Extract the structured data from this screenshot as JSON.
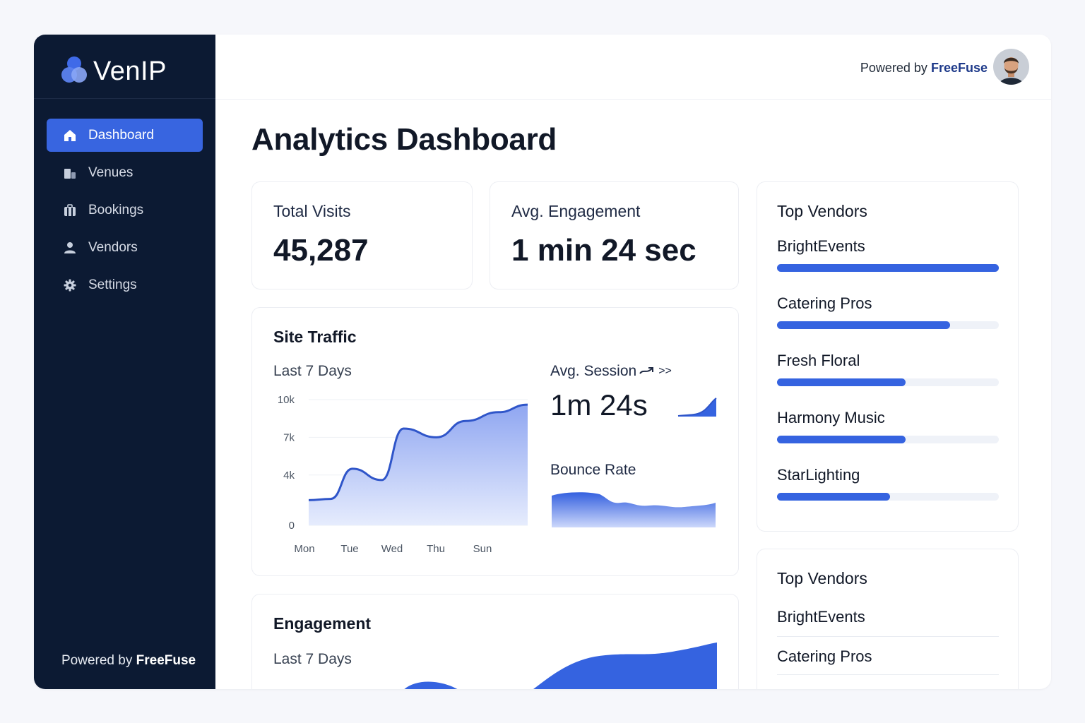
{
  "app": {
    "brand": "VenIP"
  },
  "sidebar": {
    "items": [
      {
        "label": "Dashboard",
        "icon": "home-icon",
        "active": true
      },
      {
        "label": "Venues",
        "icon": "building-icon"
      },
      {
        "label": "Bookings",
        "icon": "briefcase-icon"
      },
      {
        "label": "Vendors",
        "icon": "user-icon"
      },
      {
        "label": "Settings",
        "icon": "gear-icon"
      }
    ],
    "footer_prefix": "Powered by",
    "footer_brand": "FreeFuse"
  },
  "header": {
    "powered_prefix": "Powered by",
    "powered_brand": "FreeFuse"
  },
  "page": {
    "title": "Analytics Dashboard"
  },
  "stats": {
    "total_visits": {
      "label": "Total Visits",
      "value": "45,287"
    },
    "avg_engagement": {
      "label": "Avg. Engagement",
      "value": "1 min 24 sec"
    }
  },
  "traffic": {
    "title": "Site Traffic",
    "subtitle": "Last 7 Days",
    "avg_session_label": "Avg. Session",
    "avg_session_more": ">>",
    "avg_session_value": "1m 24s",
    "bounce_label": "Bounce Rate"
  },
  "engagement": {
    "title": "Engagement",
    "subtitle": "Last 7 Days"
  },
  "top_vendors": {
    "title": "Top Vendors",
    "items": [
      {
        "name": "BrightEvents",
        "share": 1.0
      },
      {
        "name": "Catering Pros",
        "share": 0.78
      },
      {
        "name": "Fresh Floral",
        "share": 0.58
      },
      {
        "name": "Harmony Music",
        "share": 0.58
      },
      {
        "name": "StarLighting",
        "share": 0.51
      }
    ]
  },
  "top_vendors_list": {
    "title": "Top Vendors",
    "items": [
      "BrightEvents",
      "Catering Pros"
    ]
  },
  "colors": {
    "accent": "#3563e0",
    "sidebar": "#0c1a33",
    "brand_dark": "#1e3a8a"
  },
  "chart_data": {
    "type": "area",
    "xlabel": "",
    "ylabel": "",
    "categories": [
      "Mon",
      "Tue",
      "Wed",
      "Thu",
      "Sun"
    ],
    "y_ticks": [
      "0",
      "4k",
      "7k",
      "10k"
    ],
    "ylim": [
      0,
      10000
    ],
    "x": [
      0,
      0.6,
      1.2,
      2.0,
      2.6,
      3.5,
      4.3,
      5.2,
      6.0
    ],
    "values": [
      2000,
      2100,
      4500,
      3600,
      7700,
      7000,
      8300,
      9000,
      9600
    ],
    "grid": true,
    "x_positions": [
      0,
      1,
      2,
      3,
      4
    ]
  }
}
